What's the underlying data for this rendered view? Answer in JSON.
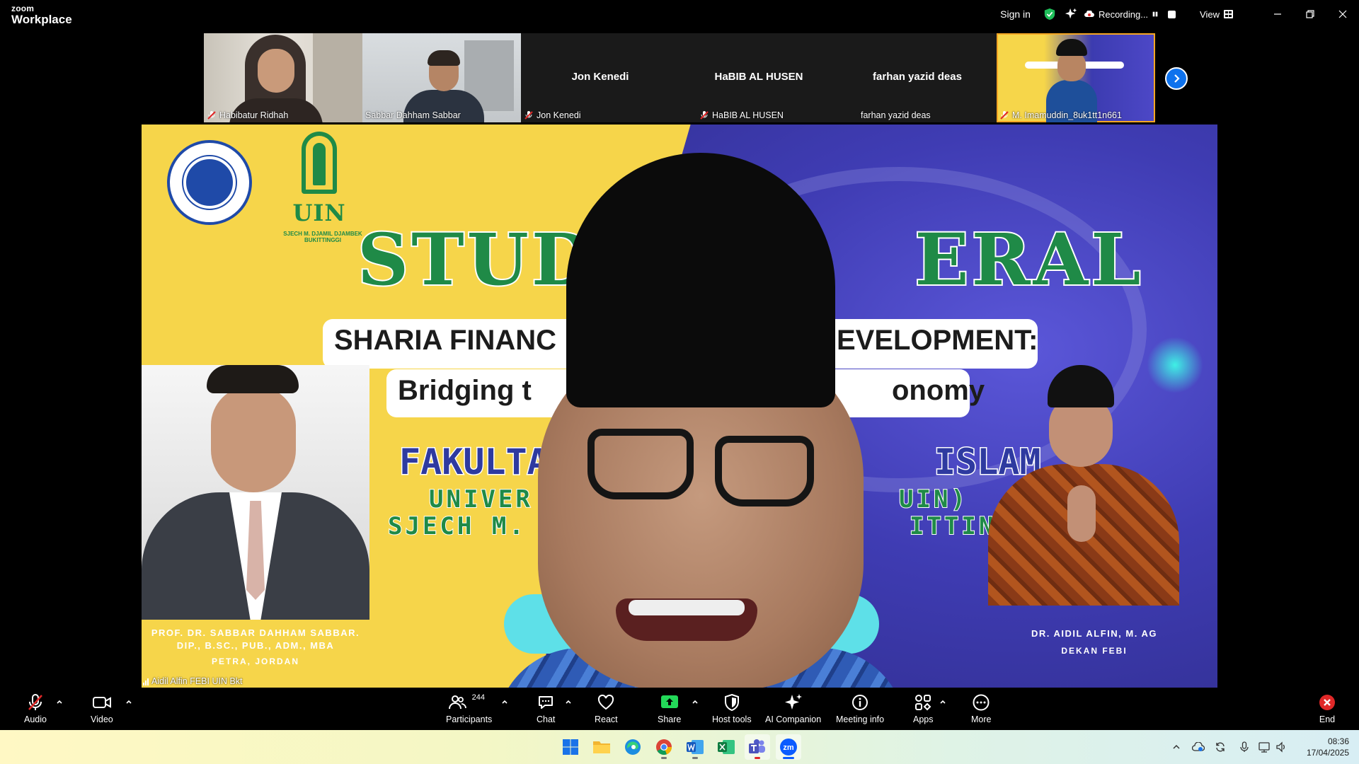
{
  "app": {
    "brand_top": "zoom",
    "brand_bottom": "Workplace"
  },
  "titlebar": {
    "sign_in": "Sign in",
    "recording": "Recording...",
    "view": "View"
  },
  "participants": [
    {
      "name": "Habibatur Ridhah",
      "muted": true,
      "video": true
    },
    {
      "name": "Sabbar Dahham Sabbar",
      "muted": false,
      "video": true
    },
    {
      "name": "Jon Kenedi",
      "display": "Jon Kenedi",
      "muted": true,
      "video": false
    },
    {
      "name": "HaBIB AL HUSEN",
      "display": "HaBIB AL HUSEN",
      "muted": true,
      "video": false
    },
    {
      "name": "farhan yazid deas",
      "display": "farhan yazid deas",
      "muted": false,
      "video": false
    },
    {
      "name": "M. Imamuddin_8uk1tt1n661",
      "muted": true,
      "video": true
    }
  ],
  "poster": {
    "uin": "UIN",
    "uin_sub": "SJECH M. DJAMIL DJAMBEK BUKITTINGGI",
    "title_left": "STUDI",
    "title_right": "ERAL",
    "line1_left": "SHARIA FINANC",
    "line1_right": "EVELOPMENT:",
    "line2_left": "Bridging t",
    "line2_right": "onomy",
    "fakultas_left": "FAKULTA",
    "fakultas_right": "ISLAM",
    "univ_left": "UNIVER",
    "univ_right": "UIN)",
    "sjech_left": "SJECH M.",
    "sjech_right": "ITTINGGI",
    "left_speaker_line1": "PROF. DR. SABBAR DAHHAM SABBAR.",
    "left_speaker_line2": "DIP., B.SC., PUB., ADM., MBA",
    "left_speaker_line3": "PETRA, JORDAN",
    "right_speaker_line1": "DR. AIDIL ALFIN, M. AG",
    "right_speaker_line2": "DEKAN FEBI"
  },
  "active_speaker": "Aidil Alfin FEBI UIN Bkt",
  "toolbar": {
    "audio": "Audio",
    "video": "Video",
    "participants": "Participants",
    "participants_count": "244",
    "chat": "Chat",
    "react": "React",
    "share": "Share",
    "host_tools": "Host tools",
    "ai_companion": "AI Companion",
    "meeting_info": "Meeting info",
    "apps": "Apps",
    "more": "More",
    "end": "End"
  },
  "taskbar": {
    "time": "08:36",
    "date": "17/04/2025"
  },
  "colors": {
    "zoom_blue": "#0e72ed",
    "share_green": "#23d959",
    "end_red": "#e02828",
    "mute_red": "#e02828",
    "shield_green": "#1fbf5a"
  }
}
